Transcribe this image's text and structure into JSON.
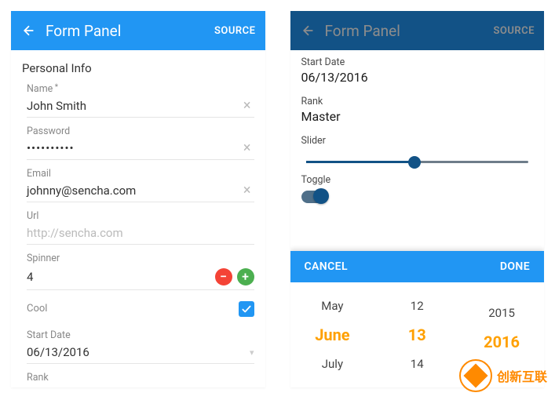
{
  "common": {
    "app_title": "Form Panel",
    "source_label": "SOURCE"
  },
  "left": {
    "section_title": "Personal Info",
    "name": {
      "label": "Name",
      "value": "John Smith"
    },
    "password": {
      "label": "Password",
      "masked": "••••••••••"
    },
    "email": {
      "label": "Email",
      "value": "johnny@sencha.com"
    },
    "url": {
      "label": "Url",
      "placeholder": "http://sencha.com"
    },
    "spinner": {
      "label": "Spinner",
      "value": "4"
    },
    "cool": {
      "label": "Cool",
      "checked": true
    },
    "start_date": {
      "label": "Start Date",
      "value": "06/13/2016"
    },
    "rank": {
      "label": "Rank"
    }
  },
  "right": {
    "start_date": {
      "label": "Start Date",
      "value": "06/13/2016"
    },
    "rank": {
      "label": "Rank",
      "value": "Master"
    },
    "slider": {
      "label": "Slider",
      "percent": 49
    },
    "toggle": {
      "label": "Toggle",
      "on": true
    },
    "picker": {
      "cancel": "CANCEL",
      "done": "DONE",
      "months": [
        "May",
        "June",
        "July"
      ],
      "days": [
        "12",
        "13",
        "14"
      ],
      "years": [
        "2015",
        "2016",
        ""
      ],
      "selected_index": 1
    }
  },
  "watermark": "创新互联"
}
